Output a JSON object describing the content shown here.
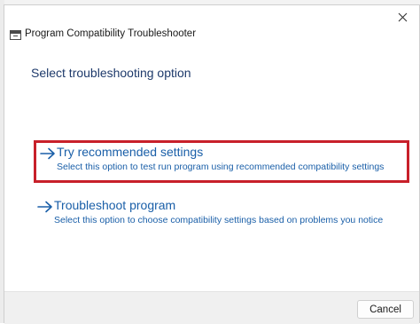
{
  "window": {
    "title": "Program Compatibility Troubleshooter",
    "title_icon": "troubleshooter-window-icon",
    "close_icon": "close-icon"
  },
  "main": {
    "heading": "Select troubleshooting option",
    "options": [
      {
        "title": "Try recommended settings",
        "description": "Select this option to test run program using recommended compatibility settings",
        "icon": "arrow-right-icon",
        "highlighted": true
      },
      {
        "title": "Troubleshoot program",
        "description": "Select this option to choose compatibility settings based on problems you notice",
        "icon": "arrow-right-icon",
        "highlighted": false
      }
    ]
  },
  "footer": {
    "cancel_label": "Cancel"
  },
  "colors": {
    "link": "#1a5fa8",
    "heading": "#1e3a6b",
    "highlight_border": "#c8202a",
    "footer_bg": "#f0f0f0"
  }
}
